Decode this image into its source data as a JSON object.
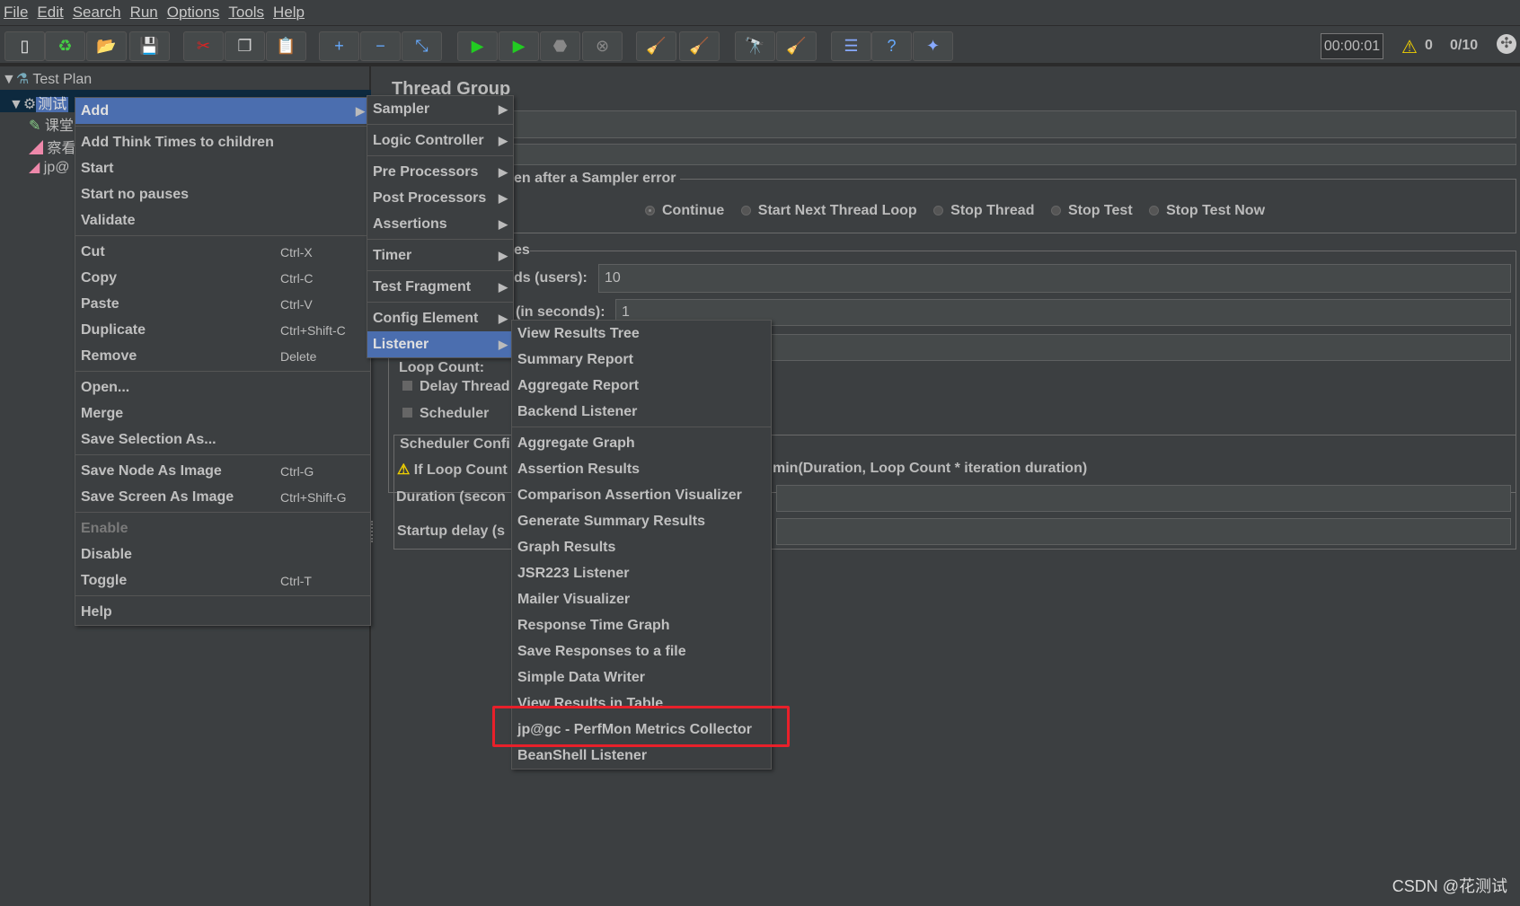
{
  "menubar": [
    "File",
    "Edit",
    "Search",
    "Run",
    "Options",
    "Tools",
    "Help"
  ],
  "toolbar": {
    "icons": [
      "new-icon",
      "templates-icon",
      "open-icon",
      "save-icon",
      "cut-icon",
      "copy-icon",
      "paste-icon",
      "expand-icon",
      "collapse-icon",
      "toggle-icon",
      "start-icon",
      "start-no-pauses-icon",
      "stop-icon",
      "shutdown-icon",
      "clear-icon",
      "clear-all-icon",
      "search-icon",
      "reset-search-icon",
      "function-helper-icon",
      "help-icon",
      "plugins-manager-icon"
    ],
    "timer": "00:00:01",
    "warnings": "0",
    "threads": "0/10"
  },
  "tree": {
    "root": "Test Plan",
    "selected": "测试",
    "children": [
      "课堂",
      "察看",
      "jp@"
    ]
  },
  "panel": {
    "title": "Thread Group",
    "sampler_error_label": "en after a Sampler error",
    "radios": [
      {
        "label": "Continue",
        "checked": true
      },
      {
        "label": "Start Next Thread Loop"
      },
      {
        "label": "Stop Thread"
      },
      {
        "label": "Stop Test"
      },
      {
        "label": "Stop Test Now"
      }
    ],
    "props_label": "es",
    "threads_label": "ds (users):",
    "threads_value": "10",
    "rampup_label": "(in seconds):",
    "rampup_value": "1",
    "loop_label": "Loop Count:",
    "delay_label": "Delay Thread",
    "scheduler_label": "Scheduler",
    "sched_config_label": "Scheduler Confi",
    "warning_text": "If Loop Count",
    "warning_rest": "min(Duration, Loop Count * iteration duration)",
    "duration_label": "Duration (secon",
    "startup_label": "Startup delay (s"
  },
  "context_menu": [
    {
      "label": "Add",
      "submenu": true,
      "highlighted": true
    },
    {
      "sep": true
    },
    {
      "label": "Add Think Times to children"
    },
    {
      "label": "Start"
    },
    {
      "label": "Start no pauses"
    },
    {
      "label": "Validate"
    },
    {
      "sep": true
    },
    {
      "label": "Cut",
      "shortcut": "Ctrl-X"
    },
    {
      "label": "Copy",
      "shortcut": "Ctrl-C"
    },
    {
      "label": "Paste",
      "shortcut": "Ctrl-V"
    },
    {
      "label": "Duplicate",
      "shortcut": "Ctrl+Shift-C"
    },
    {
      "label": "Remove",
      "shortcut": "Delete"
    },
    {
      "sep": true
    },
    {
      "label": "Open..."
    },
    {
      "label": "Merge"
    },
    {
      "label": "Save Selection As..."
    },
    {
      "sep": true
    },
    {
      "label": "Save Node As Image",
      "shortcut": "Ctrl-G"
    },
    {
      "label": "Save Screen As Image",
      "shortcut": "Ctrl+Shift-G"
    },
    {
      "sep": true
    },
    {
      "label": "Enable",
      "disabled": true
    },
    {
      "label": "Disable"
    },
    {
      "label": "Toggle",
      "shortcut": "Ctrl-T"
    },
    {
      "sep": true
    },
    {
      "label": "Help"
    }
  ],
  "add_menu": [
    {
      "label": "Sampler"
    },
    {
      "sep": true
    },
    {
      "label": "Logic Controller"
    },
    {
      "sep": true
    },
    {
      "label": "Pre Processors"
    },
    {
      "label": "Post Processors"
    },
    {
      "label": "Assertions"
    },
    {
      "sep": true
    },
    {
      "label": "Timer"
    },
    {
      "sep": true
    },
    {
      "label": "Test Fragment"
    },
    {
      "sep": true
    },
    {
      "label": "Config Element"
    },
    {
      "label": "Listener",
      "highlighted": true
    }
  ],
  "listener_menu": [
    {
      "label": "View Results Tree"
    },
    {
      "label": "Summary Report"
    },
    {
      "label": "Aggregate Report"
    },
    {
      "label": "Backend Listener"
    },
    {
      "sep": true
    },
    {
      "label": "Aggregate Graph"
    },
    {
      "label": "Assertion Results"
    },
    {
      "label": "Comparison Assertion Visualizer"
    },
    {
      "label": "Generate Summary Results"
    },
    {
      "label": "Graph Results"
    },
    {
      "label": "JSR223 Listener"
    },
    {
      "label": "Mailer Visualizer"
    },
    {
      "label": "Response Time Graph"
    },
    {
      "label": "Save Responses to a file"
    },
    {
      "label": "Simple Data Writer"
    },
    {
      "label": "View Results in Table"
    },
    {
      "label": "jp@gc - PerfMon Metrics Collector",
      "annotated": true
    },
    {
      "label": "BeanShell Listener"
    }
  ],
  "annotation_color": "#e8202a",
  "watermark": "CSDN @花测试"
}
